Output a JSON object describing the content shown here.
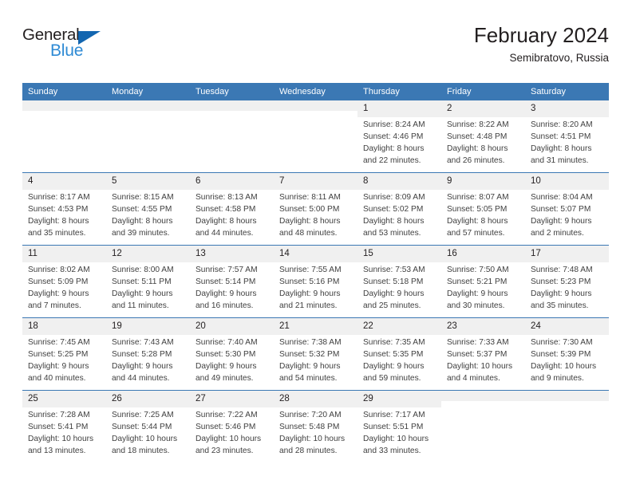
{
  "brand": {
    "name_top": "General",
    "name_bottom": "Blue",
    "triangle_color": "#1366b0",
    "blue_text_color": "#2e8ad4"
  },
  "header": {
    "title": "February 2024",
    "subtitle": "Semibratovo, Russia"
  },
  "theme": {
    "header_blue": "#3b78b4",
    "daynum_band": "#f0f0f0",
    "text": "#231f20",
    "body_text": "#404040"
  },
  "weekday_headers": [
    "Sunday",
    "Monday",
    "Tuesday",
    "Wednesday",
    "Thursday",
    "Friday",
    "Saturday"
  ],
  "weeks": [
    [
      {
        "day": "",
        "sunrise": "",
        "sunset": "",
        "daylight": "",
        "blank": true
      },
      {
        "day": "",
        "sunrise": "",
        "sunset": "",
        "daylight": "",
        "blank": true
      },
      {
        "day": "",
        "sunrise": "",
        "sunset": "",
        "daylight": "",
        "blank": true
      },
      {
        "day": "",
        "sunrise": "",
        "sunset": "",
        "daylight": "",
        "blank": true
      },
      {
        "day": "1",
        "sunrise": "Sunrise: 8:24 AM",
        "sunset": "Sunset: 4:46 PM",
        "daylight": "Daylight: 8 hours and 22 minutes."
      },
      {
        "day": "2",
        "sunrise": "Sunrise: 8:22 AM",
        "sunset": "Sunset: 4:48 PM",
        "daylight": "Daylight: 8 hours and 26 minutes."
      },
      {
        "day": "3",
        "sunrise": "Sunrise: 8:20 AM",
        "sunset": "Sunset: 4:51 PM",
        "daylight": "Daylight: 8 hours and 31 minutes."
      }
    ],
    [
      {
        "day": "4",
        "sunrise": "Sunrise: 8:17 AM",
        "sunset": "Sunset: 4:53 PM",
        "daylight": "Daylight: 8 hours and 35 minutes."
      },
      {
        "day": "5",
        "sunrise": "Sunrise: 8:15 AM",
        "sunset": "Sunset: 4:55 PM",
        "daylight": "Daylight: 8 hours and 39 minutes."
      },
      {
        "day": "6",
        "sunrise": "Sunrise: 8:13 AM",
        "sunset": "Sunset: 4:58 PM",
        "daylight": "Daylight: 8 hours and 44 minutes."
      },
      {
        "day": "7",
        "sunrise": "Sunrise: 8:11 AM",
        "sunset": "Sunset: 5:00 PM",
        "daylight": "Daylight: 8 hours and 48 minutes."
      },
      {
        "day": "8",
        "sunrise": "Sunrise: 8:09 AM",
        "sunset": "Sunset: 5:02 PM",
        "daylight": "Daylight: 8 hours and 53 minutes."
      },
      {
        "day": "9",
        "sunrise": "Sunrise: 8:07 AM",
        "sunset": "Sunset: 5:05 PM",
        "daylight": "Daylight: 8 hours and 57 minutes."
      },
      {
        "day": "10",
        "sunrise": "Sunrise: 8:04 AM",
        "sunset": "Sunset: 5:07 PM",
        "daylight": "Daylight: 9 hours and 2 minutes."
      }
    ],
    [
      {
        "day": "11",
        "sunrise": "Sunrise: 8:02 AM",
        "sunset": "Sunset: 5:09 PM",
        "daylight": "Daylight: 9 hours and 7 minutes."
      },
      {
        "day": "12",
        "sunrise": "Sunrise: 8:00 AM",
        "sunset": "Sunset: 5:11 PM",
        "daylight": "Daylight: 9 hours and 11 minutes."
      },
      {
        "day": "13",
        "sunrise": "Sunrise: 7:57 AM",
        "sunset": "Sunset: 5:14 PM",
        "daylight": "Daylight: 9 hours and 16 minutes."
      },
      {
        "day": "14",
        "sunrise": "Sunrise: 7:55 AM",
        "sunset": "Sunset: 5:16 PM",
        "daylight": "Daylight: 9 hours and 21 minutes."
      },
      {
        "day": "15",
        "sunrise": "Sunrise: 7:53 AM",
        "sunset": "Sunset: 5:18 PM",
        "daylight": "Daylight: 9 hours and 25 minutes."
      },
      {
        "day": "16",
        "sunrise": "Sunrise: 7:50 AM",
        "sunset": "Sunset: 5:21 PM",
        "daylight": "Daylight: 9 hours and 30 minutes."
      },
      {
        "day": "17",
        "sunrise": "Sunrise: 7:48 AM",
        "sunset": "Sunset: 5:23 PM",
        "daylight": "Daylight: 9 hours and 35 minutes."
      }
    ],
    [
      {
        "day": "18",
        "sunrise": "Sunrise: 7:45 AM",
        "sunset": "Sunset: 5:25 PM",
        "daylight": "Daylight: 9 hours and 40 minutes."
      },
      {
        "day": "19",
        "sunrise": "Sunrise: 7:43 AM",
        "sunset": "Sunset: 5:28 PM",
        "daylight": "Daylight: 9 hours and 44 minutes."
      },
      {
        "day": "20",
        "sunrise": "Sunrise: 7:40 AM",
        "sunset": "Sunset: 5:30 PM",
        "daylight": "Daylight: 9 hours and 49 minutes."
      },
      {
        "day": "21",
        "sunrise": "Sunrise: 7:38 AM",
        "sunset": "Sunset: 5:32 PM",
        "daylight": "Daylight: 9 hours and 54 minutes."
      },
      {
        "day": "22",
        "sunrise": "Sunrise: 7:35 AM",
        "sunset": "Sunset: 5:35 PM",
        "daylight": "Daylight: 9 hours and 59 minutes."
      },
      {
        "day": "23",
        "sunrise": "Sunrise: 7:33 AM",
        "sunset": "Sunset: 5:37 PM",
        "daylight": "Daylight: 10 hours and 4 minutes."
      },
      {
        "day": "24",
        "sunrise": "Sunrise: 7:30 AM",
        "sunset": "Sunset: 5:39 PM",
        "daylight": "Daylight: 10 hours and 9 minutes."
      }
    ],
    [
      {
        "day": "25",
        "sunrise": "Sunrise: 7:28 AM",
        "sunset": "Sunset: 5:41 PM",
        "daylight": "Daylight: 10 hours and 13 minutes."
      },
      {
        "day": "26",
        "sunrise": "Sunrise: 7:25 AM",
        "sunset": "Sunset: 5:44 PM",
        "daylight": "Daylight: 10 hours and 18 minutes."
      },
      {
        "day": "27",
        "sunrise": "Sunrise: 7:22 AM",
        "sunset": "Sunset: 5:46 PM",
        "daylight": "Daylight: 10 hours and 23 minutes."
      },
      {
        "day": "28",
        "sunrise": "Sunrise: 7:20 AM",
        "sunset": "Sunset: 5:48 PM",
        "daylight": "Daylight: 10 hours and 28 minutes."
      },
      {
        "day": "29",
        "sunrise": "Sunrise: 7:17 AM",
        "sunset": "Sunset: 5:51 PM",
        "daylight": "Daylight: 10 hours and 33 minutes."
      },
      {
        "day": "",
        "sunrise": "",
        "sunset": "",
        "daylight": "",
        "blank": true
      },
      {
        "day": "",
        "sunrise": "",
        "sunset": "",
        "daylight": "",
        "blank": true
      }
    ]
  ]
}
